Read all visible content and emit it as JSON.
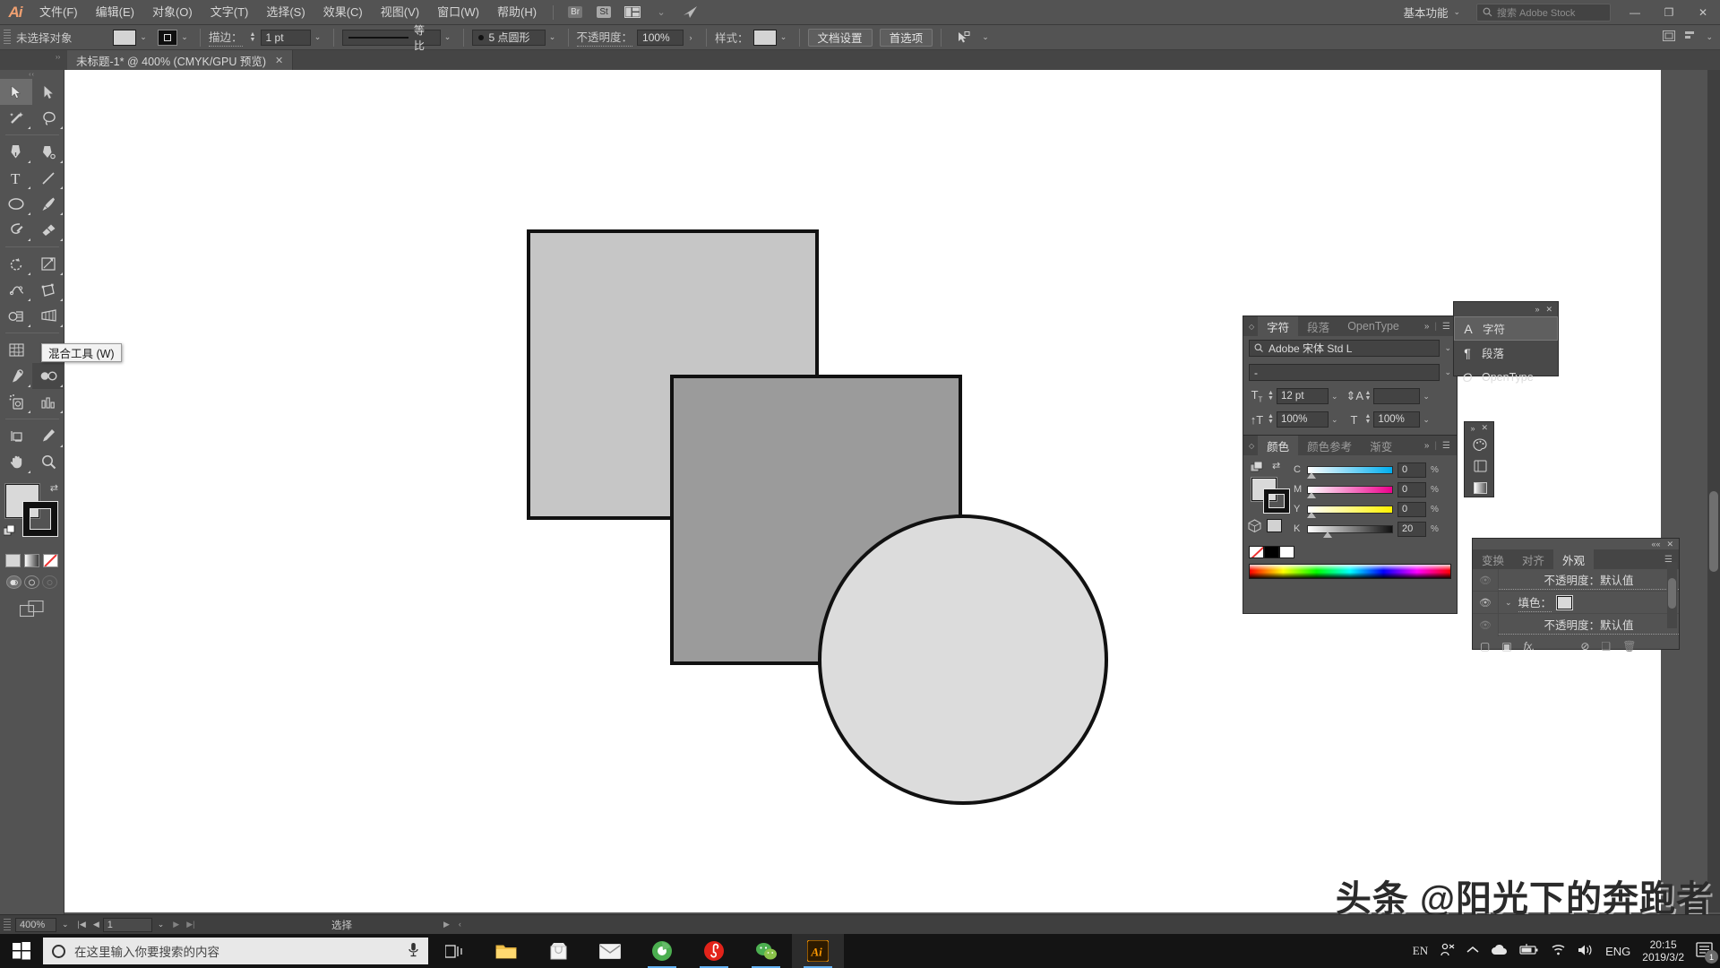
{
  "app": {
    "logo": "Ai",
    "menus": [
      "文件(F)",
      "编辑(E)",
      "对象(O)",
      "文字(T)",
      "选择(S)",
      "效果(C)",
      "视图(V)",
      "窗口(W)",
      "帮助(H)"
    ],
    "bridge_badge": "Br",
    "stock_badge": "St",
    "workspace": "基本功能",
    "stock_search_placeholder": "搜索 Adobe Stock",
    "window_minimize": "—",
    "window_restore": "❐",
    "window_close": "✕"
  },
  "control_bar": {
    "selection_status": "未选择对象",
    "stroke_label": "描边：",
    "stroke_weight": "1 pt",
    "profile_label": "等比",
    "brush_label": "5 点圆形",
    "opacity_label": "不透明度：",
    "opacity_value": "100%",
    "style_label": "样式：",
    "document_setup": "文档设置",
    "preferences": "首选项"
  },
  "document_tab": {
    "title": "未标题-1* @ 400% (CMYK/GPU 预览)",
    "close": "✕"
  },
  "tooltip": {
    "text": "混合工具 (W)"
  },
  "toolbox": {
    "tools": [
      {
        "name": "selection-tool",
        "glyph": "selection"
      },
      {
        "name": "direct-selection-tool",
        "glyph": "direct"
      },
      {
        "name": "magic-wand-tool",
        "glyph": "wand"
      },
      {
        "name": "lasso-tool",
        "glyph": "lasso"
      },
      {
        "name": "pen-tool",
        "glyph": "pen"
      },
      {
        "name": "curvature-tool",
        "glyph": "curvature"
      },
      {
        "name": "type-tool",
        "glyph": "type"
      },
      {
        "name": "line-segment-tool",
        "glyph": "line"
      },
      {
        "name": "ellipse-tool",
        "glyph": "ellipse"
      },
      {
        "name": "paintbrush-tool",
        "glyph": "brush"
      },
      {
        "name": "shaper-tool",
        "glyph": "shaper"
      },
      {
        "name": "eraser-tool",
        "glyph": "eraser"
      },
      {
        "name": "rotate-tool",
        "glyph": "rotate"
      },
      {
        "name": "scale-tool",
        "glyph": "scale"
      },
      {
        "name": "width-tool",
        "glyph": "width"
      },
      {
        "name": "free-transform-tool",
        "glyph": "freetransform"
      },
      {
        "name": "shape-builder-tool",
        "glyph": "shapebuilder"
      },
      {
        "name": "perspective-grid-tool",
        "glyph": "perspective"
      },
      {
        "name": "mesh-tool",
        "glyph": "mesh"
      },
      {
        "name": "gradient-tool",
        "glyph": "gradient"
      },
      {
        "name": "eyedropper-tool",
        "glyph": "eyedropper"
      },
      {
        "name": "blend-tool",
        "glyph": "blend"
      },
      {
        "name": "symbol-sprayer-tool",
        "glyph": "symbol"
      },
      {
        "name": "column-graph-tool",
        "glyph": "graph"
      },
      {
        "name": "artboard-tool",
        "glyph": "artboard"
      },
      {
        "name": "slice-tool",
        "glyph": "slice"
      },
      {
        "name": "hand-tool",
        "glyph": "hand"
      },
      {
        "name": "zoom-tool",
        "glyph": "zoom"
      }
    ],
    "fill_color": "#d9d9d9",
    "stroke_color": "#111111"
  },
  "character_panel": {
    "tabs": [
      "字符",
      "段落",
      "OpenType"
    ],
    "active_tab": "字符",
    "font_family": "Adobe 宋体 Std L",
    "font_style": "-",
    "font_size": "12 pt",
    "leading": "",
    "horizontal_scale": "100%",
    "vertical_scale": "100%"
  },
  "character_flyout": {
    "items": [
      {
        "label": "字符",
        "icon": "A"
      },
      {
        "label": "段落",
        "icon": "¶"
      },
      {
        "label": "OpenType",
        "icon": "O"
      }
    ],
    "selected": "字符"
  },
  "color_panel": {
    "tabs": [
      "颜色",
      "颜色参考",
      "渐变"
    ],
    "active_tab": "颜色",
    "mode": "CMYK",
    "channels": [
      {
        "label": "C",
        "value": "0",
        "unit": "%"
      },
      {
        "label": "M",
        "value": "0",
        "unit": "%"
      },
      {
        "label": "Y",
        "value": "0",
        "unit": "%"
      },
      {
        "label": "K",
        "value": "20",
        "unit": "%"
      }
    ],
    "fill_color": "#d2d2d2"
  },
  "appearance_panel": {
    "tabs": [
      "变换",
      "对齐",
      "外观"
    ],
    "active_tab": "外观",
    "rows": [
      {
        "label": "不透明度：默认值",
        "type": "opacity",
        "eye": "dim"
      },
      {
        "label": "填色：",
        "type": "fill",
        "eye": "on",
        "swatch": "#d9d9d9"
      },
      {
        "label": "不透明度：默认值",
        "type": "opacity",
        "eye": "dim"
      }
    ]
  },
  "status_bar": {
    "zoom": "400%",
    "page": "1",
    "status_text": "选择"
  },
  "canvas": {
    "shapes": [
      {
        "name": "light-gray-square",
        "fill": "#c6c6c6",
        "stroke": "#111111"
      },
      {
        "name": "medium-gray-square",
        "fill": "#9b9b9b",
        "stroke": "#111111"
      },
      {
        "name": "light-gray-circle",
        "fill": "#dcdcdc",
        "stroke": "#111111"
      }
    ]
  },
  "watermark": {
    "text": "头条 @阳光下的奔跑者"
  },
  "taskbar": {
    "search_placeholder": "在这里输入你要搜索的内容",
    "apps": [
      {
        "name": "task-view",
        "glyph": "taskview"
      },
      {
        "name": "file-explorer",
        "glyph": "folder"
      },
      {
        "name": "microsoft-store",
        "glyph": "store"
      },
      {
        "name": "mail",
        "glyph": "mail"
      },
      {
        "name": "browser",
        "glyph": "browser"
      },
      {
        "name": "netease-music",
        "glyph": "music"
      },
      {
        "name": "wechat",
        "glyph": "wechat"
      },
      {
        "name": "illustrator",
        "glyph": "ai"
      }
    ],
    "tray": {
      "ime_left": "EN",
      "language": "ENG",
      "time": "20:15",
      "date": "2019/3/2",
      "notification_count": "1"
    }
  }
}
